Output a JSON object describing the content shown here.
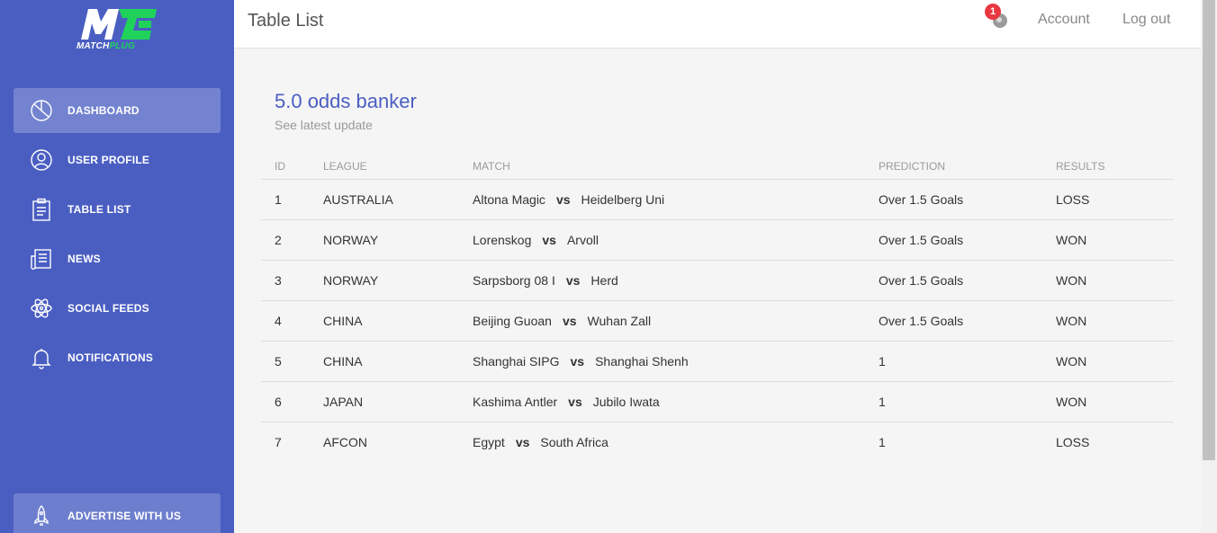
{
  "brand": {
    "logo_mark": "MC",
    "name_main": "MATCH",
    "name_accent": "PLUG",
    "accent_color": "#1fd35a",
    "sidebar_color": "#4a5ec2"
  },
  "sidebar": {
    "items": [
      {
        "label": "DASHBOARD",
        "icon": "pie-chart-icon",
        "active": true
      },
      {
        "label": "USER PROFILE",
        "icon": "user-icon",
        "active": false
      },
      {
        "label": "TABLE LIST",
        "icon": "clipboard-icon",
        "active": false
      },
      {
        "label": "NEWS",
        "icon": "newspaper-icon",
        "active": false
      },
      {
        "label": "SOCIAL FEEDS",
        "icon": "atom-icon",
        "active": false
      },
      {
        "label": "NOTIFICATIONS",
        "icon": "bell-icon",
        "active": false
      }
    ],
    "advertise": {
      "label": "ADVERTISE WITH US",
      "icon": "rocket-icon"
    }
  },
  "header": {
    "title": "Table List",
    "notification_count": "1",
    "account_label": "Account",
    "logout_label": "Log out"
  },
  "card": {
    "title": "5.0 odds banker",
    "subtitle": "See latest update"
  },
  "table": {
    "columns": [
      "ID",
      "LEAGUE",
      "MATCH",
      "PREDICTION",
      "RESULTS"
    ],
    "vs_label": "vs",
    "rows": [
      {
        "id": "1",
        "league": "AUSTRALIA",
        "home": "Altona Magic",
        "away": "Heidelberg Uni",
        "prediction": "Over 1.5 Goals",
        "result": "LOSS"
      },
      {
        "id": "2",
        "league": "NORWAY",
        "home": "Lorenskog",
        "away": "Arvoll",
        "prediction": "Over 1.5 Goals",
        "result": "WON"
      },
      {
        "id": "3",
        "league": "NORWAY",
        "home": "Sarpsborg 08 I",
        "away": "Herd",
        "prediction": "Over 1.5 Goals",
        "result": "WON"
      },
      {
        "id": "4",
        "league": "CHINA",
        "home": "Beijing Guoan",
        "away": "Wuhan Zall",
        "prediction": "Over 1.5 Goals",
        "result": "WON"
      },
      {
        "id": "5",
        "league": "CHINA",
        "home": "Shanghai SIPG",
        "away": "Shanghai Shenh",
        "prediction": "1",
        "result": "WON"
      },
      {
        "id": "6",
        "league": "JAPAN",
        "home": "Kashima Antler",
        "away": "Jubilo Iwata",
        "prediction": "1",
        "result": "WON"
      },
      {
        "id": "7",
        "league": "AFCON",
        "home": "Egypt",
        "away": "South Africa",
        "prediction": "1",
        "result": "LOSS"
      }
    ]
  }
}
